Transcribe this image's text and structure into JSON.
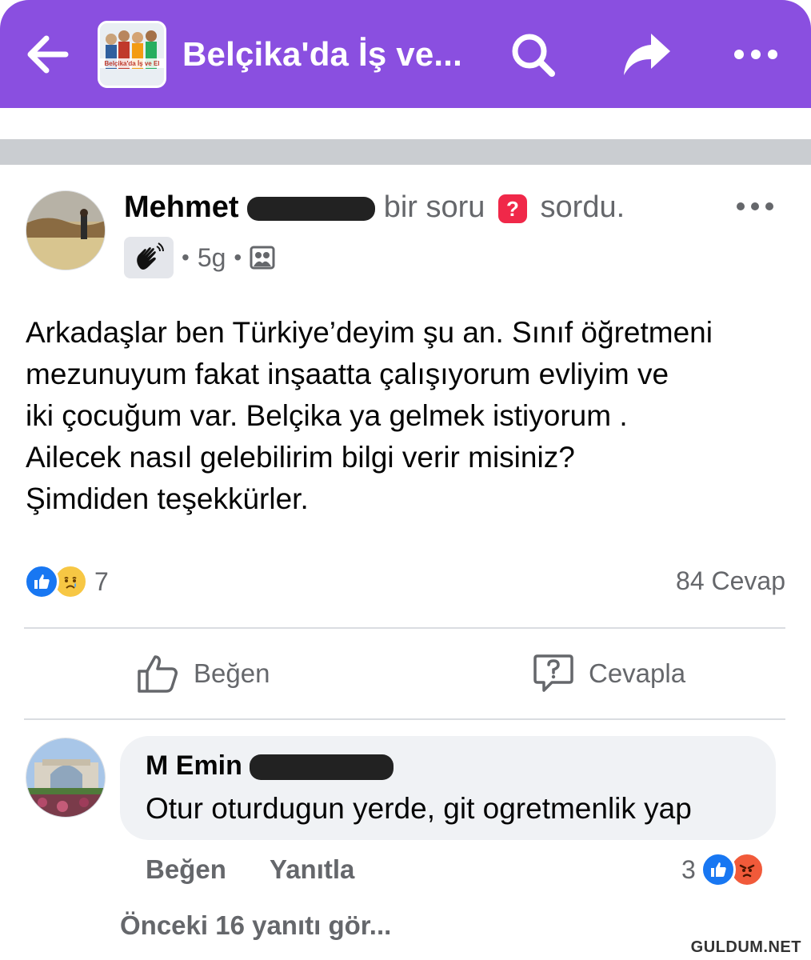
{
  "header": {
    "title": "Belçika'da İş ve...",
    "group_image_text": "Belçika'da İş ve El",
    "accent_color": "#8a4fe0"
  },
  "icons": {
    "back": "back-arrow-icon",
    "search": "search-icon",
    "share": "share-icon",
    "more": "more-dots-icon"
  },
  "post": {
    "author": "Mehmet",
    "action_prefix": "bir soru",
    "action_suffix": "sordu.",
    "question_badge": "?",
    "time": "5g",
    "body_lines": [
      "Arkadaşlar ben Türkiye’deyim şu an. Sınıf öğretmeni",
      "mezunuyum fakat inşaatta çalışıyorum evliyim ve",
      "iki çocuğum var. Belçika ya  gelmek istiyorum .",
      "Ailecek nasıl gelebilirim bilgi verir misiniz?",
      "Şimdiden teşekkürler."
    ],
    "reaction_count": "7",
    "reply_count": "84 Cevap",
    "like_label": "Beğen",
    "answer_label": "Cevapla"
  },
  "comment": {
    "author": "M Emin",
    "text": "Otur oturdugun yerde, git ogretmenlik yap",
    "like_label": "Beğen",
    "reply_label": "Yanıtla",
    "reaction_count": "3"
  },
  "previous_replies": "Önceki 16 yanıtı gör...",
  "watermark": "GULDUM.NET"
}
